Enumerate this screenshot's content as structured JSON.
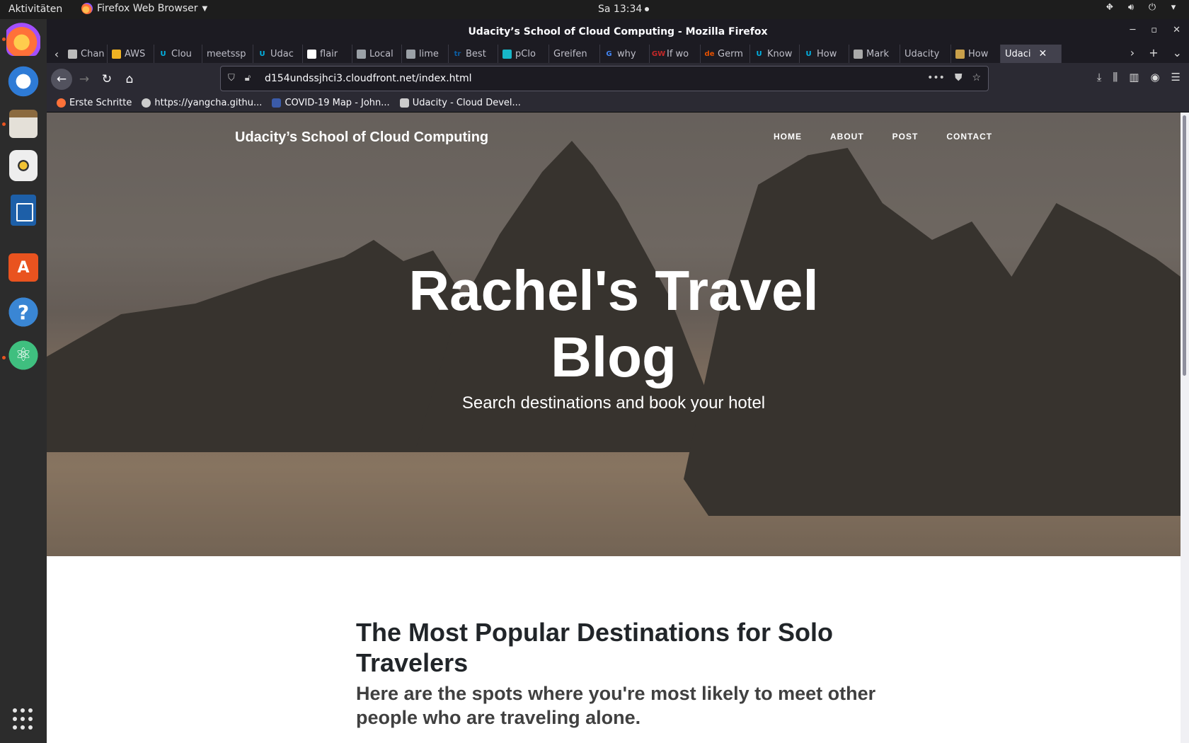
{
  "topbar": {
    "activities": "Aktivitäten",
    "app_menu": "Firefox Web Browser",
    "clock": "Sa 13:34"
  },
  "window": {
    "title": "Udacity’s School of Cloud Computing - Mozilla Firefox"
  },
  "tabs": [
    {
      "label": "Chan",
      "fav": "doc",
      "color": "#bbbbbb"
    },
    {
      "label": "AWS",
      "fav": "box",
      "color": "#f0b323"
    },
    {
      "label": "Clou",
      "fav": "U",
      "color": "#02b3e4"
    },
    {
      "label": "meetssp",
      "fav": "",
      "color": ""
    },
    {
      "label": "Udac",
      "fav": "U",
      "color": "#02b3e4"
    },
    {
      "label": "flair",
      "fav": "github",
      "color": "#ffffff"
    },
    {
      "label": "Local",
      "fav": "grid",
      "color": "#9aa0a6"
    },
    {
      "label": "lime",
      "fav": "grid",
      "color": "#9aa0a6"
    },
    {
      "label": "Best",
      "fav": "tr",
      "color": "#0b5fa5"
    },
    {
      "label": "pClo",
      "fav": "cloud",
      "color": "#17b6c8"
    },
    {
      "label": "Greifen",
      "fav": "",
      "color": ""
    },
    {
      "label": "why",
      "fav": "G",
      "color": "#4285f4"
    },
    {
      "label": "If wo",
      "fav": "GW",
      "color": "#c62828"
    },
    {
      "label": "Germ",
      "fav": "de",
      "color": "#e65100"
    },
    {
      "label": "Know",
      "fav": "U",
      "color": "#02b3e4"
    },
    {
      "label": "How",
      "fav": "U",
      "color": "#02b3e4"
    },
    {
      "label": "Mark",
      "fav": "quote",
      "color": "#aaaaaa"
    },
    {
      "label": "Udacity",
      "fav": "",
      "color": ""
    },
    {
      "label": "How",
      "fav": "circle",
      "color": "#c9a04a"
    },
    {
      "label": "Udaci",
      "fav": "",
      "color": "",
      "active": true
    }
  ],
  "url": "d154undssjhci3.cloudfront.net/index.html",
  "bookmarks": [
    {
      "label": "Erste Schritte",
      "icon": "firefox-icon"
    },
    {
      "label": "https://yangcha.githu...",
      "icon": "globe-icon"
    },
    {
      "label": "COVID-19 Map - John...",
      "icon": "shield-icon"
    },
    {
      "label": "Udacity - Cloud Devel...",
      "icon": "folder-icon"
    }
  ],
  "site": {
    "brand": "Udacity’s School of Cloud Computing",
    "nav": [
      "HOME",
      "ABOUT",
      "POST",
      "CONTACT"
    ],
    "hero_title_line1": "Rachel's Travel",
    "hero_title_line2": "Blog",
    "hero_subtitle": "Search destinations and book your hotel",
    "post_title": "The Most Popular Destinations for Solo Travelers",
    "post_subtitle": "Here are the spots where you're most likely to meet other people who are traveling alone."
  },
  "colors": {
    "firefox_chrome": "#1c1b22",
    "navbar": "#2b2a33",
    "accent_ubuntu": "#e95420",
    "heading": "#212529"
  }
}
